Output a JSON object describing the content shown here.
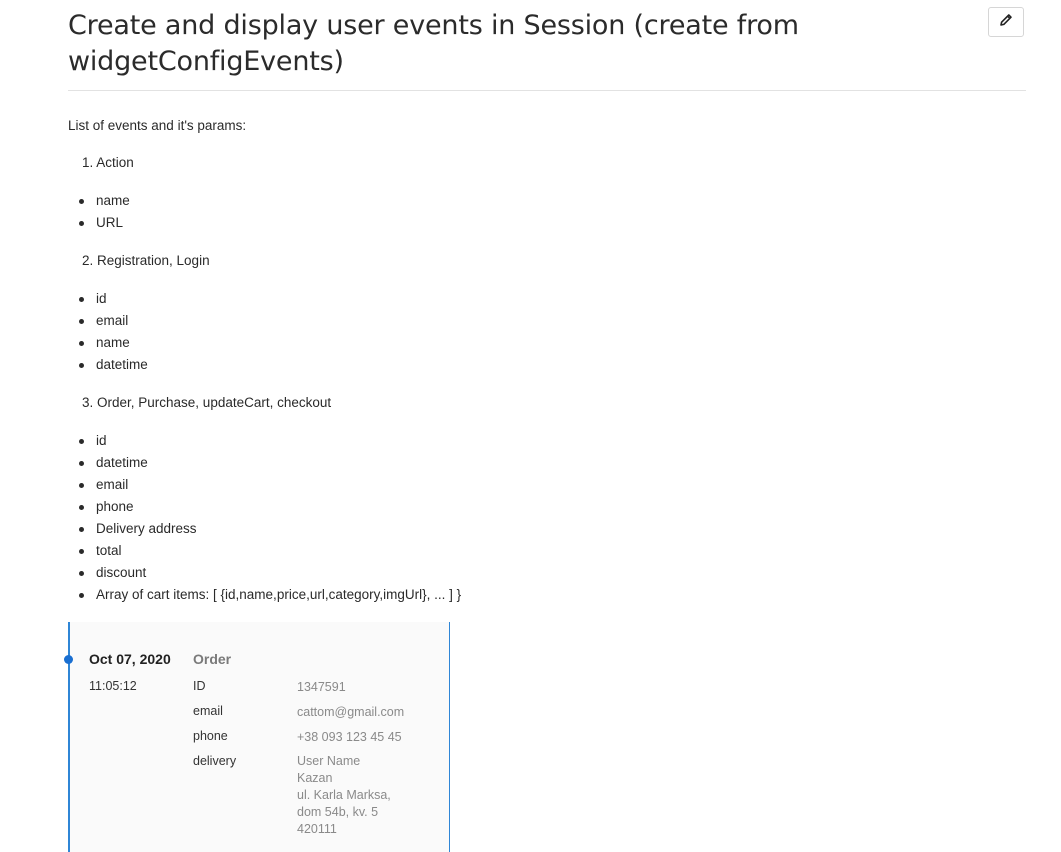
{
  "page": {
    "title": "Create and display user events in Session (create from widgetConfigEvents)",
    "edit_icon": "pencil-icon"
  },
  "description": {
    "intro": "List of events and it's params:",
    "sections": [
      {
        "heading": "1. Action",
        "params": [
          "name",
          "URL"
        ]
      },
      {
        "heading": "2. Registration, Login",
        "params": [
          "id",
          "email",
          "name",
          "datetime"
        ]
      },
      {
        "heading": "3. Order, Purchase, updateCart, checkout",
        "params": [
          "id",
          "datetime",
          "email",
          "phone",
          "Delivery address",
          "total",
          "discount",
          "Array of cart items: [ {id,name,price,url,category,imgUrl}, ... ] }"
        ]
      }
    ]
  },
  "event": {
    "date": "Oct 07, 2020",
    "time": "11:05:12",
    "type": "Order",
    "fields": [
      {
        "key": "ID",
        "value": [
          "1347591"
        ]
      },
      {
        "key": "email",
        "value": [
          "cattom@gmail.com"
        ]
      },
      {
        "key": "phone",
        "value": [
          "+38 093 123 45 45"
        ]
      },
      {
        "key": "delivery",
        "value": [
          "User Name",
          "Kazan",
          "ul. Karla Marksa,",
          "dom 54b, kv. 5",
          "420111"
        ]
      }
    ]
  },
  "colors": {
    "accent": "#2f86d6",
    "dot": "#1a6fd1",
    "muted": "#8a8a8a"
  }
}
